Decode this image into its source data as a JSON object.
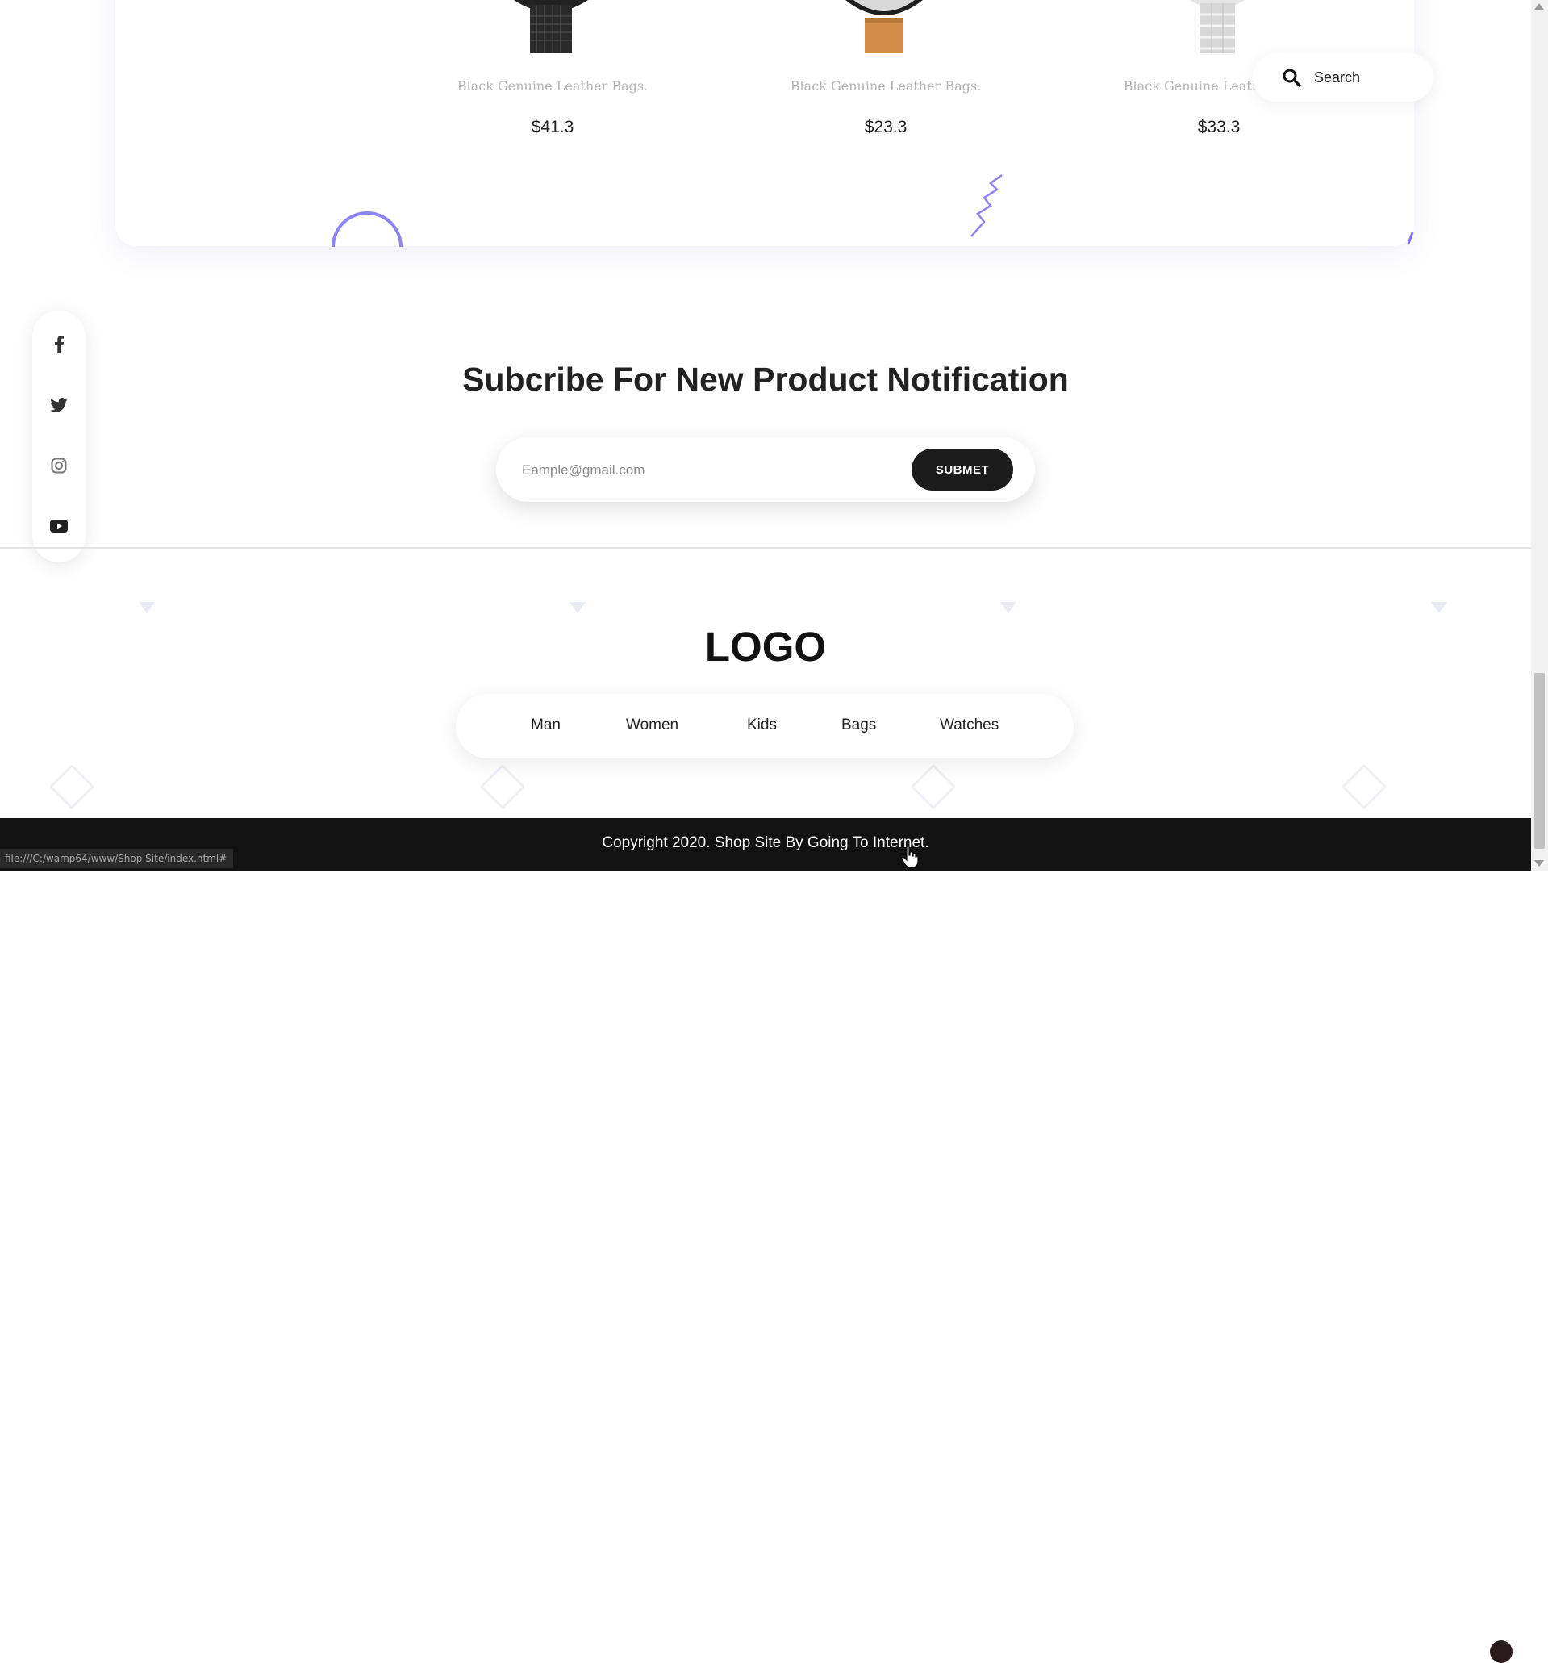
{
  "products": [
    {
      "title": "Black Genuine Leather Bags.",
      "price": "$41.3",
      "icon": "black-mesh-watch"
    },
    {
      "title": "Black Genuine Leather Bags.",
      "price": "$23.3",
      "icon": "brown-leather-watch"
    },
    {
      "title": "Black Genuine Leather Bags.",
      "price": "$33.3",
      "icon": "silver-steel-watch"
    }
  ],
  "search": {
    "label": "Search",
    "icon": "search-icon"
  },
  "social": [
    "facebook-icon",
    "twitter-icon",
    "instagram-icon",
    "youtube-icon"
  ],
  "subscribe": {
    "title": "Subcribe For New Product Notification",
    "placeholder": "Eample@gmail.com",
    "button": "SUBMET"
  },
  "footer": {
    "logo": "LOGO",
    "nav": [
      "Man",
      "Women",
      "Kids",
      "Bags",
      "Watches"
    ],
    "copyright": "Copyright 2020. Shop Site By Going To Internet."
  },
  "status_bar": {
    "url": "file:///C:/wamp64/www/Shop Site/index.html#"
  },
  "colors": {
    "accent": "#7b6ff0",
    "dark": "#1c1c1c",
    "footer": "#121212"
  }
}
